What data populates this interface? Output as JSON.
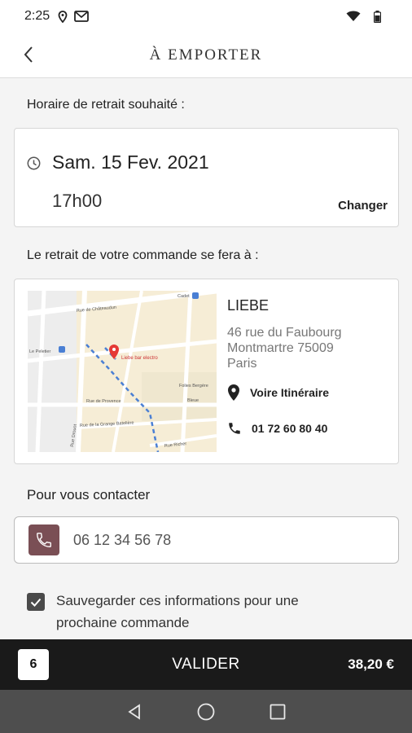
{
  "status_bar": {
    "time": "2:25"
  },
  "header": {
    "title": "À EMPORTER"
  },
  "pickup": {
    "label": "Horaire de retrait souhaité :",
    "date": "Sam. 15 Fev. 2021",
    "time": "17h00",
    "change_label": "Changer"
  },
  "location": {
    "label": "Le retrait de votre commande se fera à :",
    "store_name": "LIEBE",
    "address_lines": [
      "46 rue du Faubourg",
      "Montmartre 75009",
      "Paris"
    ],
    "itinerary_label": "Voire Itinéraire",
    "phone": "01 72 60 80 40",
    "map": {
      "pin_label": "Liebe bar electro",
      "street_labels": [
        "Cadet",
        "Rue de Châteaudun",
        "Le Peletier",
        "Folies Bergère",
        "Rue Drouot",
        "Rue de Provence",
        "Rue de la Grange Batelière",
        "Bleue",
        "Rue Richer"
      ]
    }
  },
  "contact": {
    "label": "Pour vous contacter",
    "phone_value": "06 12 34 56 78"
  },
  "save_info": {
    "checked": true,
    "label": "Sauvegarder ces informations pour une prochaine commande"
  },
  "checkout": {
    "count": "6",
    "validate_label": "VALIDER",
    "total": "38,20 €"
  },
  "colors": {
    "accent": "#7a4f55",
    "bottom_bar": "#1a1a1a",
    "nav_bar": "#4e4e4e",
    "map_pin": "#e53935",
    "route": "#4a7fd4"
  },
  "icons": [
    "location-status-icon",
    "gmail-icon",
    "wifi-icon",
    "battery-icon",
    "back-arrow-icon",
    "clock-icon",
    "map-pin-icon",
    "phone-icon",
    "check-icon",
    "nav-back-icon",
    "nav-home-icon",
    "nav-recents-icon"
  ]
}
